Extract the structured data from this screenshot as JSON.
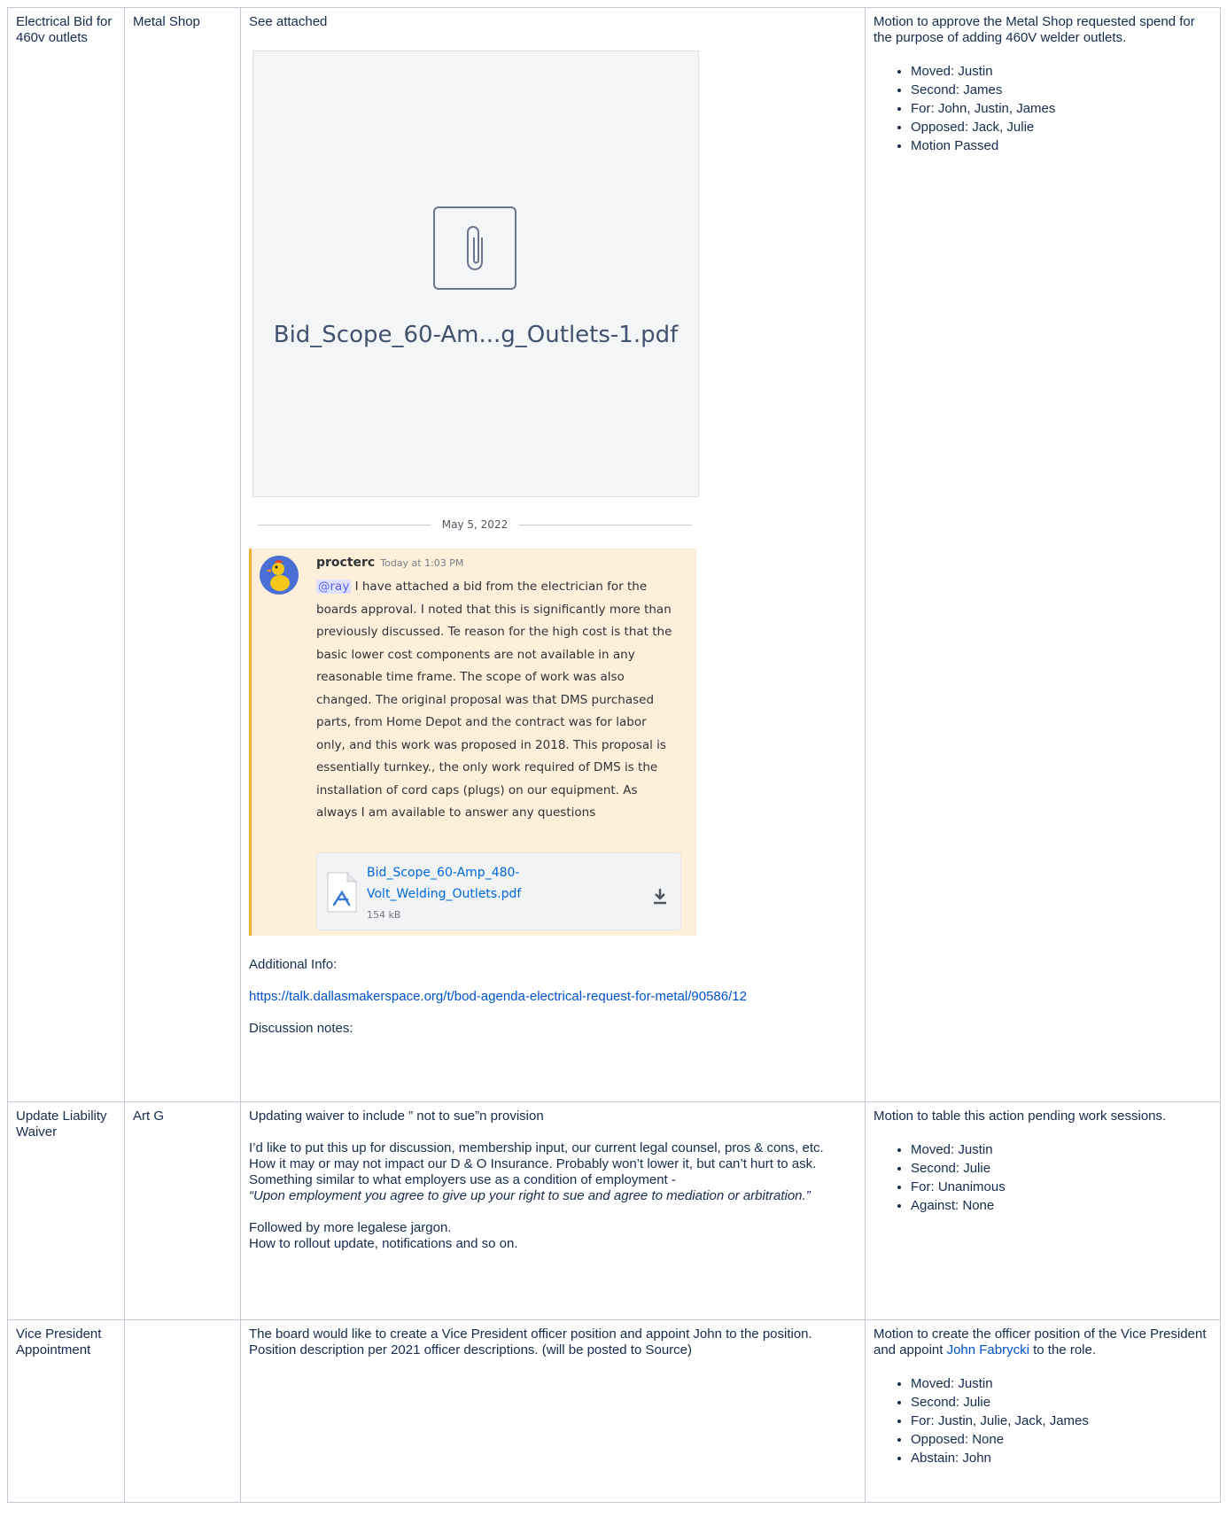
{
  "rows": [
    {
      "topic": "Electrical Bid for 460v outlets",
      "owner": "Metal Shop",
      "notes": {
        "intro": "See attached",
        "attachment_preview_name": "Bid_Scope_60-Am...g_Outlets-1.pdf",
        "chat": {
          "date_separator": "May 5, 2022",
          "username": "procterc",
          "timestamp": "Today at 1:03 PM",
          "mention": "@ray",
          "message": " I have attached a bid from the electrician for the boards approval. I noted that this is significantly more than previously discussed. Te reason for the high cost is that the basic lower cost components are not available in any reasonable time frame. The scope of work was also changed. The original proposal was that DMS purchased parts, from Home Depot and the contract was for labor only, and this work was proposed in 2018. This proposal is essentially turnkey., the only work required of DMS is the installation of cord caps (plugs) on our equipment. As always I am available to answer any questions",
          "file_name": "Bid_Scope_60-Amp_480-Volt_Welding_Outlets.pdf",
          "file_size": "154 kB"
        },
        "additional_info_label": "Additional Info:",
        "link": "https://talk.dallasmakerspace.org/t/bod-agenda-electrical-request-for-metal/90586/12",
        "discussion_label": "Discussion notes:"
      },
      "motion": "Motion to approve the Metal Shop requested spend for the purpose of adding 460V welder outlets.",
      "votes": [
        "Moved: Justin",
        "Second: James",
        "For: John, Justin, James",
        "Opposed: Jack, Julie",
        "Motion Passed"
      ]
    },
    {
      "topic": "Update Liability Waiver",
      "owner": "Art G",
      "notes": {
        "intro": "Updating waiver to include ” not to sue”n provision",
        "lines": [
          "I’d like to put this up for discussion, membership input, our current legal counsel, pros & cons, etc.",
          "How it may or may not impact our D & O Insurance. Probably won’t lower it, but can’t hurt to ask.",
          "Something similar to what employers use as a condition of employment -"
        ],
        "quote": "“Upon employment you agree to give up your right to sue and agree to mediation or arbitration.”",
        "closing": [
          "Followed by more legalese jargon.",
          "How to rollout update, notifications and so on."
        ]
      },
      "motion": "Motion to table this action pending work sessions.",
      "votes": [
        "Moved: Justin",
        "Second: Julie",
        "For: Unanimous",
        "Against: None"
      ]
    },
    {
      "topic": "Vice President Appointment",
      "owner": "",
      "notes": {
        "intro": "The board would like to create a Vice President officer position and appoint John to the position. Position description per 2021 officer descriptions. (will be posted to Source)"
      },
      "motion_before": "Motion to create the officer position of the Vice President and appoint ",
      "motion_link": "John Fabrycki",
      "motion_after": " to the role.",
      "votes": [
        "Moved: Justin",
        "Second: Julie",
        "For: Justin, Julie, Jack, James",
        "Opposed: None",
        "Abstain: John"
      ]
    }
  ],
  "icons": {
    "attachment": "paperclip-icon",
    "pdf": "pdf-file-icon",
    "download": "download-icon",
    "avatar": "user-avatar-duck"
  },
  "colors": {
    "link": "#0052cc",
    "chat_highlight_bg": "#fdefd9",
    "chat_highlight_border": "#f0b232",
    "mention": "#5865f2"
  }
}
